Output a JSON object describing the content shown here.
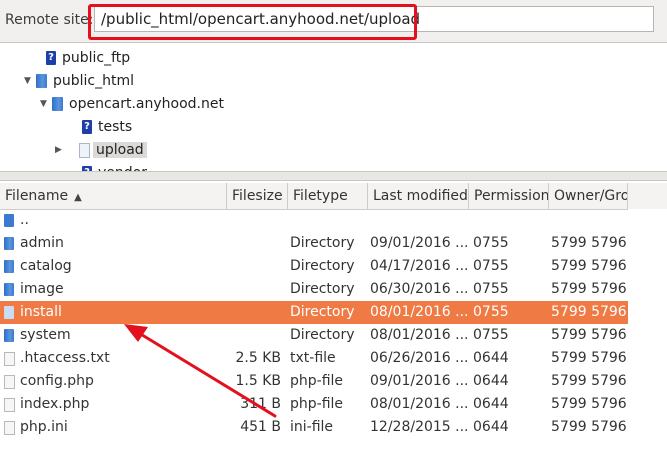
{
  "remote": {
    "label": "Remote site:",
    "path": "/public_html/opencart.anyhood.net/upload"
  },
  "tree": {
    "nodes": [
      {
        "label": "public_ftp",
        "icon": "unknown-folder-icon",
        "arrow": ""
      },
      {
        "label": "public_html",
        "icon": "folder-icon",
        "arrow": "▼"
      },
      {
        "label": "opencart.anyhood.net",
        "icon": "folder-icon",
        "arrow": "▼"
      },
      {
        "label": "tests",
        "icon": "unknown-folder-icon",
        "arrow": ""
      },
      {
        "label": "upload",
        "icon": "link-folder-icon",
        "arrow": "▶"
      },
      {
        "label": "vendor",
        "icon": "unknown-folder-icon",
        "arrow": ""
      }
    ]
  },
  "columns": {
    "filename": "Filename",
    "filesize": "Filesize",
    "filetype": "Filetype",
    "modified": "Last modified",
    "permission": "Permission",
    "owner": "Owner/Gro"
  },
  "files": [
    {
      "name": "..",
      "size": "",
      "type": "",
      "modified": "",
      "perm": "",
      "owner": "",
      "icon": "up-folder-icon"
    },
    {
      "name": "admin",
      "size": "",
      "type": "Directory",
      "modified": "09/01/2016 ...",
      "perm": "0755",
      "owner": "5799 5796",
      "icon": "folder-icon"
    },
    {
      "name": "catalog",
      "size": "",
      "type": "Directory",
      "modified": "04/17/2016 ...",
      "perm": "0755",
      "owner": "5799 5796",
      "icon": "folder-icon"
    },
    {
      "name": "image",
      "size": "",
      "type": "Directory",
      "modified": "06/30/2016 ...",
      "perm": "0755",
      "owner": "5799 5796",
      "icon": "folder-icon"
    },
    {
      "name": "install",
      "size": "",
      "type": "Directory",
      "modified": "08/01/2016 ...",
      "perm": "0755",
      "owner": "5799 5796",
      "icon": "folder-icon"
    },
    {
      "name": "system",
      "size": "",
      "type": "Directory",
      "modified": "08/01/2016 ...",
      "perm": "0755",
      "owner": "5799 5796",
      "icon": "folder-icon"
    },
    {
      "name": ".htaccess.txt",
      "size": "2.5 KB",
      "type": "txt-file",
      "modified": "06/26/2016 ...",
      "perm": "0644",
      "owner": "5799 5796",
      "icon": "file-icon"
    },
    {
      "name": "config.php",
      "size": "1.5 KB",
      "type": "php-file",
      "modified": "09/01/2016 ...",
      "perm": "0644",
      "owner": "5799 5796",
      "icon": "file-icon"
    },
    {
      "name": "index.php",
      "size": "311 B",
      "type": "php-file",
      "modified": "08/01/2016 ...",
      "perm": "0644",
      "owner": "5799 5796",
      "icon": "file-icon"
    },
    {
      "name": "php.ini",
      "size": "451 B",
      "type": "ini-file",
      "modified": "12/28/2015 ...",
      "perm": "0644",
      "owner": "5799 5796",
      "icon": "file-icon"
    }
  ],
  "selected_file": "install",
  "colors": {
    "selection": "#ef7a44",
    "annotation": "#e4101d",
    "folder": "#3b7ad0"
  }
}
